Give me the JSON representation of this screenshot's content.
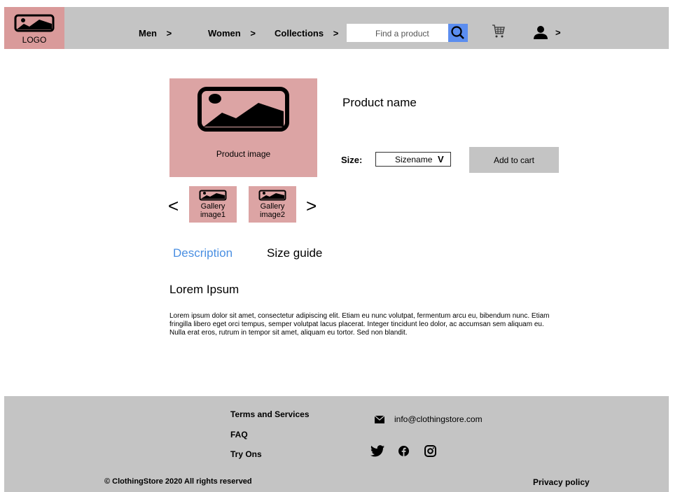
{
  "header": {
    "logo_label": "LOGO",
    "nav": [
      {
        "label": "Men",
        "chevron": ">"
      },
      {
        "label": "Women",
        "chevron": ">"
      },
      {
        "label": "Collections",
        "chevron": ">"
      }
    ],
    "search_placeholder": "Find a product",
    "account_chevron": ">",
    "colors": {
      "bar": "#c4c4c4",
      "logo_bg": "#d99a9a",
      "search_button": "#5b8def"
    }
  },
  "product": {
    "image_label": "Product image",
    "name": "Product name",
    "size_label": "Size:",
    "size_value": "Sizename",
    "size_chevron": "V",
    "add_to_cart": "Add to cart",
    "gallery": [
      {
        "line1": "Gallery",
        "line2": "image1"
      },
      {
        "line1": "Gallery",
        "line2": "image2"
      }
    ],
    "prev_arrow": "<",
    "next_arrow": ">"
  },
  "tabs": {
    "description": "Description",
    "size_guide": "Size guide",
    "active_color": "#4a8fe2"
  },
  "content": {
    "heading": "Lorem Ipsum",
    "body": "Lorem ipsum dolor sit amet, consectetur adipiscing elit. Etiam eu nunc volutpat, fermentum arcu eu, bibendum nunc. Etiam fringilla libero eget orci tempus, semper volutpat lacus placerat. Integer tincidunt leo dolor, ac accumsan sem aliquam eu. Nulla erat eros, rutrum in tempor sit amet, aliquam eu tortor. Sed non blandit."
  },
  "footer": {
    "links": [
      "Terms and Services",
      "FAQ",
      "Try Ons"
    ],
    "email": "info@clothingstore.com",
    "social_icons": [
      "twitter-icon",
      "facebook-icon",
      "instagram-icon"
    ],
    "copyright": "© ClothingStore 2020 All rights reserved",
    "privacy": "Privacy policy"
  }
}
